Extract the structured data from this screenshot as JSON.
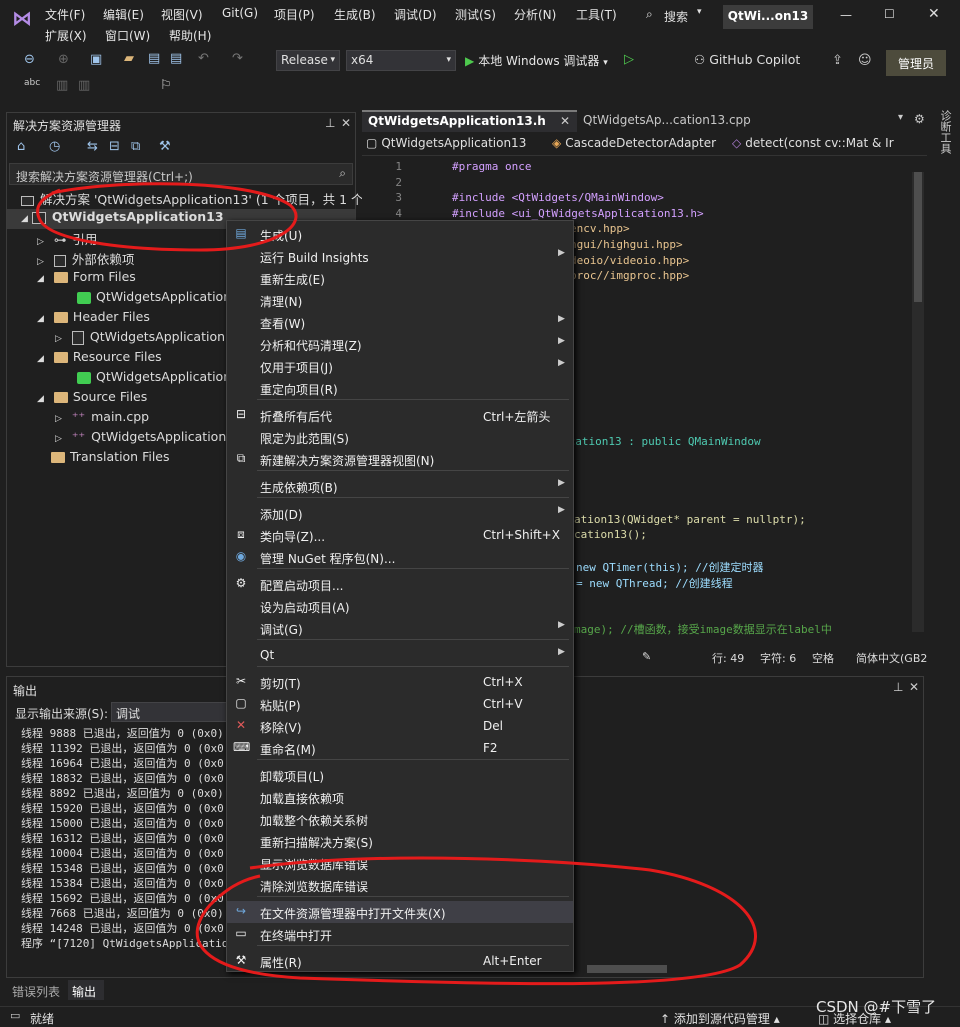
{
  "titlebar": {
    "menus": [
      "文件(F)",
      "编辑(E)",
      "视图(V)",
      "Git(G)",
      "项目(P)",
      "生成(B)",
      "调试(D)",
      "测试(S)",
      "分析(N)",
      "工具(T)",
      "扩展(X)",
      "窗口(W)",
      "帮助(H)"
    ],
    "search": "搜索",
    "title": "QtWi...on13"
  },
  "toolbar": {
    "config": "Release",
    "platform": "x64",
    "debugger": "本地 Windows 调试器",
    "copilot": "GitHub Copilot",
    "admin": "管理员"
  },
  "solution": {
    "title": "解决方案资源管理器",
    "search_placeholder": "搜索解决方案资源管理器(Ctrl+;)",
    "root": "解决方案 'QtWidgetsApplication13' (1 个项目，共 1 个)",
    "project": "QtWidgetsApplication13",
    "items": [
      "引用",
      "外部依赖项",
      "Form Files",
      "QtWidgetsApplication",
      "Header Files",
      "QtWidgetsApplication",
      "Resource Files",
      "QtWidgetsApplication",
      "Source Files",
      "main.cpp",
      "QtWidgetsApplication",
      "Translation Files"
    ]
  },
  "editor": {
    "tab1": "QtWidgetsApplication13.h",
    "tab2": "QtWidgetsAp...cation13.cpp",
    "nav1": "QtWidgetsApplication13",
    "nav2": "CascadeDetectorAdapter",
    "nav3": "detect(const cv::Mat & Ir",
    "lines": [
      {
        "n": "1",
        "t": "#pragma once",
        "c": "#d3a0ff"
      },
      {
        "n": "2",
        "t": "",
        "c": "#d6d6d6"
      },
      {
        "n": "3",
        "t": "#include <QtWidgets/QMainWindow>",
        "c": "#d3a0ff"
      },
      {
        "n": "4",
        "t": "#include <ui_QtWidgetsApplication13.h>",
        "c": "#d3a0ff"
      },
      {
        "n": "5",
        "t": "encv.hpp>",
        "c": "#e8c48f"
      },
      {
        "n": "6",
        "t": "hgui/highgui.hpp>",
        "c": "#e8c48f"
      },
      {
        "n": "7",
        "t": "deoio/videoio.hpp>",
        "c": "#e8c48f"
      },
      {
        "n": "8",
        "t": "proc//imgproc.hpp>",
        "c": "#e8c48f"
      }
    ],
    "frag1": "ication13 : public QMainWindow",
    "frag2": "ation13(QWidget* parent = nullptr);",
    "frag3": "cation13();",
    "frag4": "new QTimer(this); //创建定时器",
    "frag5": "= new QThread; //创建线程",
    "frag6": "mage); //槽函数，接受image数据显示在label中",
    "status": {
      "line": "行: 49",
      "col": "字符: 6",
      "space": "空格",
      "enc": "简体中文(GB2"
    }
  },
  "output": {
    "title": "输出",
    "source_label": "显示输出来源(S):",
    "source": "调试",
    "lines": [
      "线程 9888 已退出，返回值为 0 (0x0)",
      "线程 11392 已退出，返回值为 0 (0x0",
      "线程 16964 已退出，返回值为 0 (0x0",
      "线程 18832 已退出，返回值为 0 (0x0",
      "线程 8892 已退出，返回值为 0 (0x0)",
      "线程 15920 已退出，返回值为 0 (0x0",
      "线程 15000 已退出，返回值为 0 (0x0",
      "线程 16312 已退出，返回值为 0 (0x0",
      "线程 10004 已退出，返回值为 0 (0x0",
      "线程 15348 已退出，返回值为 0 (0x0",
      "线程 15384 已退出，返回值为 0 (0x0",
      "线程 15692 已退出，返回值为 0 (0x0",
      "线程 7668 已退出，返回值为 0 (0x0)",
      "线程 14248 已退出，返回值为 0 (0x0",
      "程序 “[7120] QtWidgetsApplication1"
    ],
    "tab_errors": "错误列表",
    "tab_output": "输出"
  },
  "context_menu": [
    {
      "label": "生成(U)",
      "icon": "build-icon"
    },
    {
      "label": "运行 Build Insights",
      "arrow": true
    },
    {
      "label": "重新生成(E)"
    },
    {
      "label": "清理(N)"
    },
    {
      "label": "查看(W)",
      "arrow": true
    },
    {
      "label": "分析和代码清理(Z)",
      "arrow": true
    },
    {
      "label": "仅用于项目(J)",
      "arrow": true
    },
    {
      "label": "重定向项目(R)"
    },
    {
      "label": "折叠所有后代",
      "shortcut": "Ctrl+左箭头",
      "icon": "collapse-icon"
    },
    {
      "label": "限定为此范围(S)"
    },
    {
      "label": "新建解决方案资源管理器视图(N)",
      "icon": "new-view-icon"
    },
    {
      "label": "生成依赖项(B)",
      "arrow": true
    },
    {
      "label": "添加(D)",
      "arrow": true
    },
    {
      "label": "类向导(Z)...",
      "shortcut": "Ctrl+Shift+X",
      "icon": "class-wizard-icon"
    },
    {
      "label": "管理 NuGet 程序包(N)...",
      "icon": "nuget-icon"
    },
    {
      "label": "配置启动项目...",
      "icon": "gear-icon"
    },
    {
      "label": "设为启动项目(A)"
    },
    {
      "label": "调试(G)",
      "arrow": true
    },
    {
      "label": "Qt",
      "arrow": true
    },
    {
      "label": "剪切(T)",
      "shortcut": "Ctrl+X",
      "icon": "scissors-icon"
    },
    {
      "label": "粘贴(P)",
      "shortcut": "Ctrl+V",
      "icon": "paste-icon"
    },
    {
      "label": "移除(V)",
      "shortcut": "Del",
      "icon": "remove-icon"
    },
    {
      "label": "重命名(M)",
      "shortcut": "F2",
      "icon": "rename-icon"
    },
    {
      "label": "卸载项目(L)"
    },
    {
      "label": "加载直接依赖项"
    },
    {
      "label": "加载整个依赖关系树"
    },
    {
      "label": "重新扫描解决方案(S)"
    },
    {
      "label": "显示浏览数据库错误"
    },
    {
      "label": "清除浏览数据库错误"
    },
    {
      "label": "在文件资源管理器中打开文件夹(X)",
      "icon": "open-folder-icon"
    },
    {
      "label": "在终端中打开",
      "icon": "terminal-icon"
    },
    {
      "label": "属性(R)",
      "shortcut": "Alt+Enter",
      "icon": "wrench-icon"
    }
  ],
  "statusbar": {
    "ready": "就绪",
    "add_source": "添加到源代码管理",
    "repo": "选择仓库",
    "watermark": "CSDN @#下雪了"
  },
  "side": {
    "diag": "诊断工具"
  }
}
